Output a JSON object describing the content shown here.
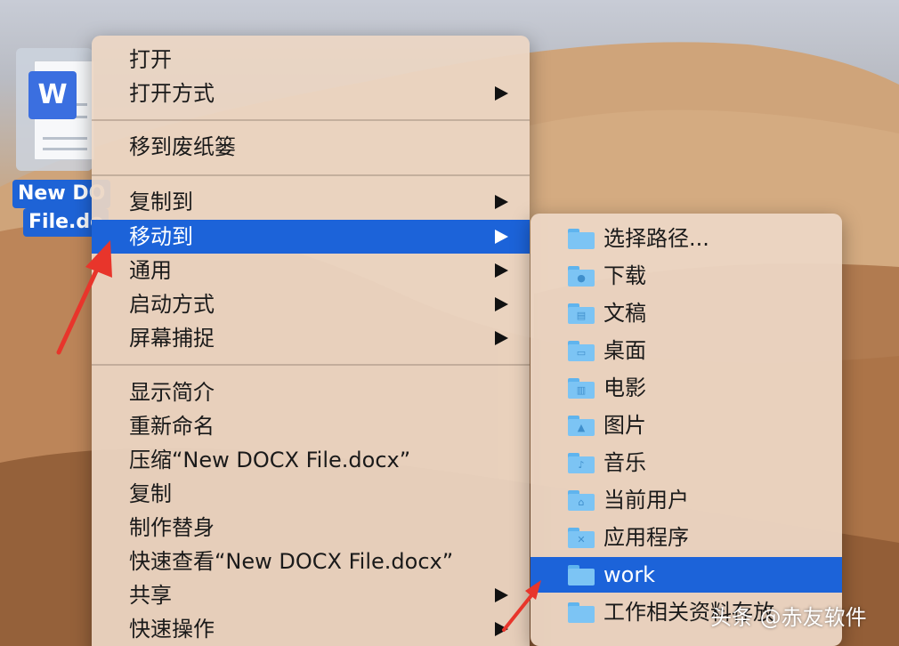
{
  "file": {
    "icon_name": "word-document-icon",
    "badge_letter": "W",
    "label_line1": "New DO",
    "label_line2": "File.do"
  },
  "context_menu": {
    "items": [
      {
        "label": "打开",
        "submenu": false
      },
      {
        "label": "打开方式",
        "submenu": true
      },
      {
        "label": "移到废纸篓",
        "submenu": false
      },
      {
        "label": "复制到",
        "submenu": true
      },
      {
        "label": "移动到",
        "submenu": true,
        "selected": true
      },
      {
        "label": "通用",
        "submenu": true
      },
      {
        "label": "启动方式",
        "submenu": true
      },
      {
        "label": "屏幕捕捉",
        "submenu": true
      },
      {
        "label": "显示简介",
        "submenu": false
      },
      {
        "label": "重新命名",
        "submenu": false
      },
      {
        "label": "压缩“New DOCX File.docx”",
        "submenu": false
      },
      {
        "label": "复制",
        "submenu": false
      },
      {
        "label": "制作替身",
        "submenu": false
      },
      {
        "label": "快速查看“New DOCX File.docx”",
        "submenu": false
      },
      {
        "label": "共享",
        "submenu": true
      },
      {
        "label": "快速操作",
        "submenu": true
      }
    ]
  },
  "move_to_submenu": {
    "items": [
      {
        "label": "选择路径...",
        "icon": "folder-icon"
      },
      {
        "label": "下载",
        "icon": "downloads-folder-icon"
      },
      {
        "label": "文稿",
        "icon": "documents-folder-icon"
      },
      {
        "label": "桌面",
        "icon": "desktop-folder-icon"
      },
      {
        "label": "电影",
        "icon": "movies-folder-icon"
      },
      {
        "label": "图片",
        "icon": "pictures-folder-icon"
      },
      {
        "label": "音乐",
        "icon": "music-folder-icon"
      },
      {
        "label": "当前用户",
        "icon": "home-folder-icon"
      },
      {
        "label": "应用程序",
        "icon": "applications-folder-icon"
      },
      {
        "label": "work",
        "icon": "folder-icon",
        "selected": true
      },
      {
        "label": "工作相关资料存放",
        "icon": "folder-icon"
      }
    ]
  },
  "watermark": "头条 @赤友软件",
  "colors": {
    "selection": "#1c63d9",
    "folder": "#7cc4f4",
    "annotation_arrow": "#e8352b"
  }
}
